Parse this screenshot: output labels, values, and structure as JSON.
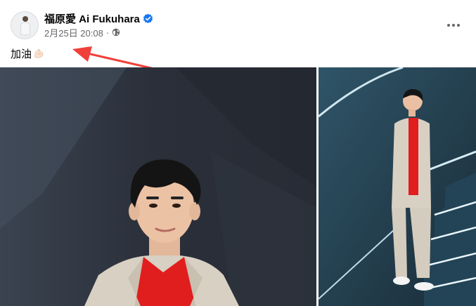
{
  "post": {
    "author_name": "福原愛 Ai Fukuhara",
    "timestamp": "2月25日 20:08",
    "separator": "·",
    "audience_icon": "globe-icon",
    "verified_icon": "verified-badge-icon",
    "more_icon": "more-options-icon",
    "text": "加油",
    "emoji": "flexed-biceps-icon"
  },
  "annotation": {
    "arrow_color": "#f0403a"
  },
  "photos": [
    {
      "name": "photo-main",
      "subject": "portrait-red-shirt-beige-blazer"
    },
    {
      "name": "photo-side",
      "subject": "full-body-leaning-on-wall-stairs"
    }
  ],
  "colors": {
    "verified": "#1877f2",
    "secondary_text": "#65676b",
    "shirt_red": "#e01e1e",
    "blazer": "#d8d0c3"
  }
}
